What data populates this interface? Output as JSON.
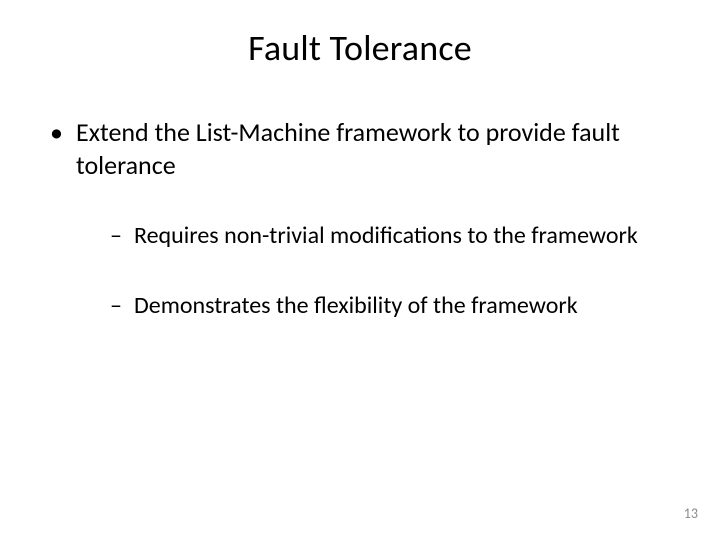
{
  "title": "Fault Tolerance",
  "bullets": {
    "main": "Extend the List-Machine framework to provide fault tolerance",
    "sub1": "Requires non-trivial modifications to the framework",
    "sub2": "Demonstrates the flexibility of the framework"
  },
  "page_number": "13"
}
